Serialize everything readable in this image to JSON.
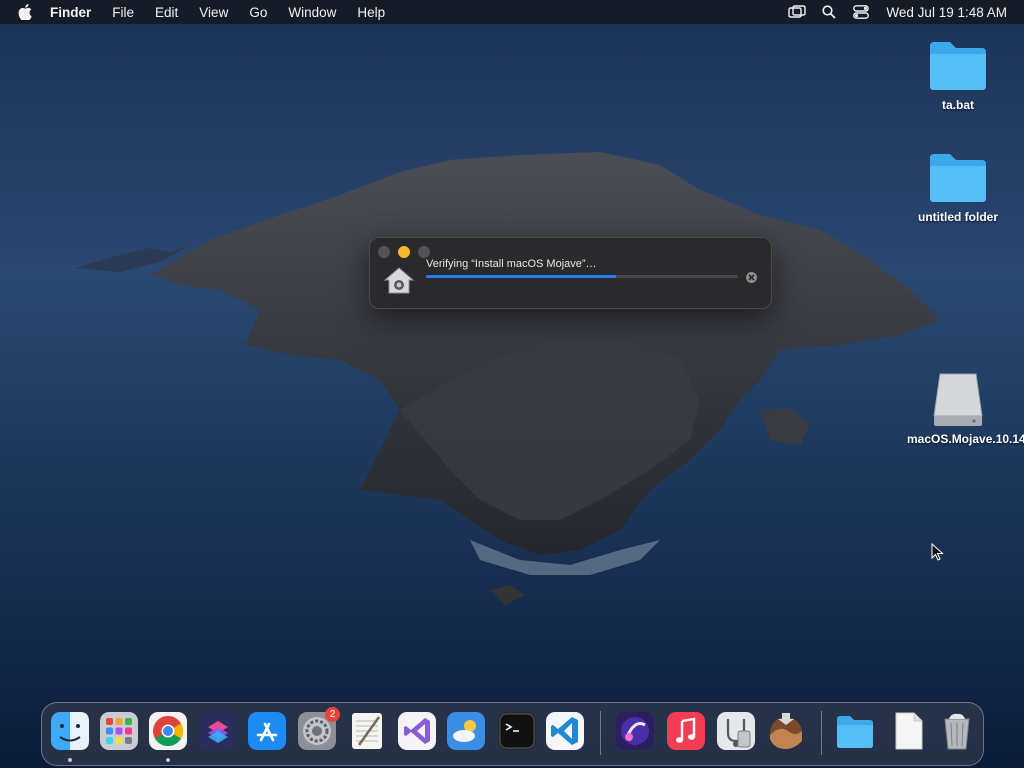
{
  "menubar": {
    "app_name": "Finder",
    "items": [
      "File",
      "Edit",
      "View",
      "Go",
      "Window",
      "Help"
    ],
    "clock": "Wed Jul 19  1:48 AM",
    "status_icons": [
      "screen-mirroring-icon",
      "search-icon",
      "control-center-icon"
    ]
  },
  "desktop": {
    "icons": [
      {
        "label": "ta.bat",
        "kind": "folder"
      },
      {
        "label": "untitled folder",
        "kind": "folder"
      },
      {
        "label": "macOS.Mojave.10.14",
        "kind": "disk-image"
      }
    ]
  },
  "progress_window": {
    "message": "Verifying “Install macOS Mojave”…",
    "progress": 0.61,
    "accent": "#2a7df0",
    "icon": "installer-home-icon"
  },
  "dock": {
    "apps": [
      {
        "name": "finder",
        "icon": "finder-icon",
        "running": true
      },
      {
        "name": "launchpad",
        "icon": "launchpad-icon",
        "running": false
      },
      {
        "name": "chrome",
        "icon": "chrome-icon",
        "running": true
      },
      {
        "name": "shortcuts",
        "icon": "shortcuts-icon",
        "running": false
      },
      {
        "name": "app-store",
        "icon": "app-store-icon",
        "running": false
      },
      {
        "name": "system-preferences",
        "icon": "gear-icon",
        "running": false,
        "badge": "2"
      },
      {
        "name": "textedit",
        "icon": "textedit-icon",
        "running": false
      },
      {
        "name": "visual-studio",
        "icon": "visual-studio-icon",
        "running": false
      },
      {
        "name": "weather",
        "icon": "weather-icon",
        "running": false
      },
      {
        "name": "terminal",
        "icon": "terminal-icon",
        "running": false
      },
      {
        "name": "vscode",
        "icon": "vscode-icon",
        "running": false
      },
      {
        "name": "cleanmymac",
        "icon": "cleanmymac-icon",
        "running": false
      },
      {
        "name": "music",
        "icon": "music-icon",
        "running": false
      },
      {
        "name": "disk-utility",
        "icon": "disk-utility-icon",
        "running": false
      },
      {
        "name": "install-macos-mojave",
        "icon": "mojave-installer-icon",
        "running": false
      },
      {
        "name": "downloads",
        "icon": "folder-icon",
        "running": false
      },
      {
        "name": "document",
        "icon": "document-icon",
        "running": false
      },
      {
        "name": "trash",
        "icon": "trash-icon",
        "running": false
      }
    ]
  }
}
